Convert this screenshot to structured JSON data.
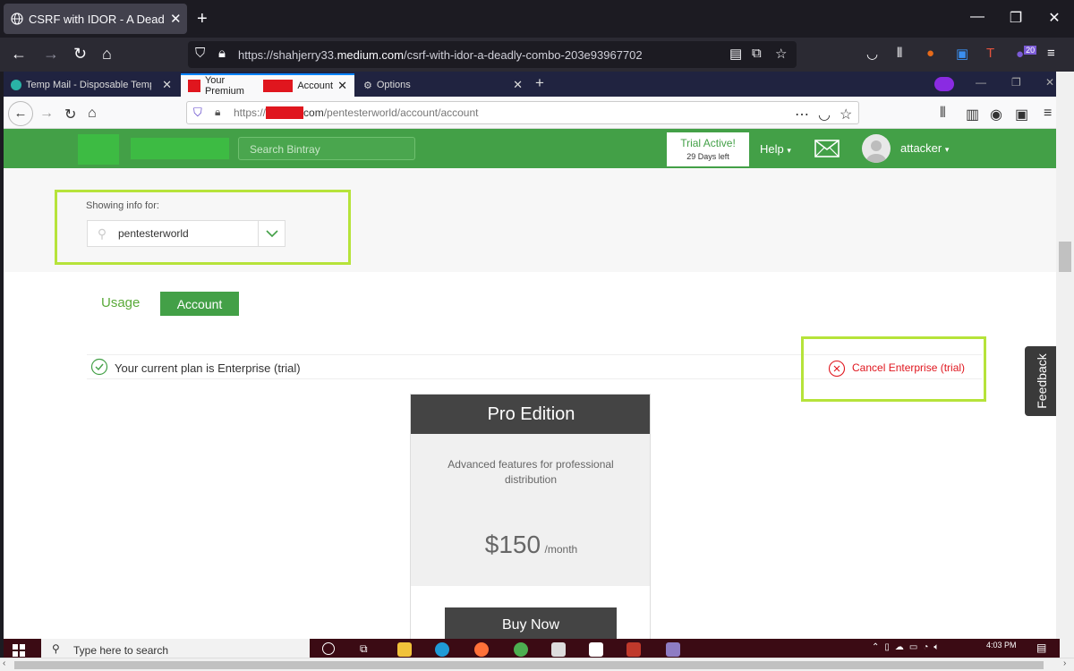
{
  "outer_browser": {
    "tab_title": "CSRF with IDOR - A Deadly Con",
    "url_prefix": "https://shahjerry33.",
    "url_domain": "medium.com",
    "url_path": "/csrf-with-idor-a-deadly-combo-203e93967702",
    "extension_badge": "20"
  },
  "inner_browser": {
    "tabs": [
      {
        "label": "Temp Mail - Disposable Tempo"
      },
      {
        "label_start": "Your Premium",
        "label_end": "Account"
      },
      {
        "label": "Options"
      }
    ],
    "url_prefix": "https://",
    "url_domain_end": "com",
    "url_path": "/pentesterworld/account/account"
  },
  "header": {
    "search_placeholder": "Search Bintray",
    "trial_title": "Trial Active!",
    "trial_days": "29 Days left",
    "help_label": "Help",
    "username": "attacker"
  },
  "org": {
    "label": "Showing info for:",
    "selected": "pentesterworld"
  },
  "tabs": {
    "usage": "Usage",
    "account": "Account"
  },
  "plan": {
    "current_text": "Your current plan is Enterprise (trial)",
    "cancel_text": "Cancel Enterprise (trial)"
  },
  "feedback_label": "Feedback",
  "pro_card": {
    "title": "Pro Edition",
    "description": "Advanced features for professional distribution",
    "price": "$150",
    "period": "/month",
    "buy_label": "Buy Now"
  },
  "taskbar": {
    "search_placeholder": "Type here to search",
    "time": "4:03 PM"
  },
  "colors": {
    "brand_green": "#43a047",
    "highlight": "#b6e33a",
    "danger": "#e0161e"
  }
}
